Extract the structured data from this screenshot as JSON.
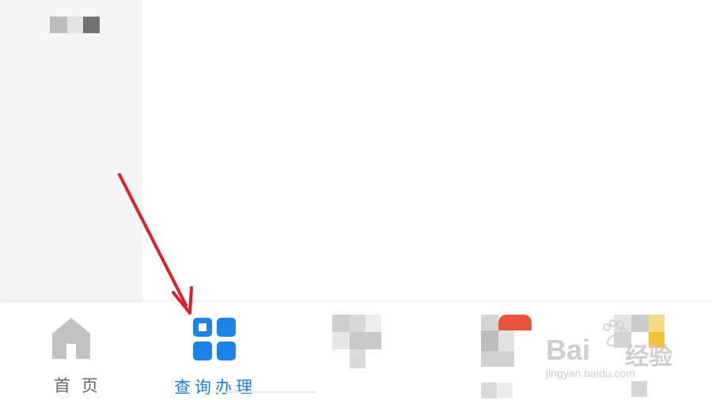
{
  "tabbar": {
    "items": [
      {
        "label": "首页",
        "icon": "home-icon",
        "active": false
      },
      {
        "label": "查询办理",
        "icon": "grid-icon",
        "active": true
      },
      {
        "label": "",
        "icon": "blurred-icon",
        "active": false
      },
      {
        "label": "",
        "icon": "blurred-icon",
        "active": false
      },
      {
        "label": "",
        "icon": "blurred-icon",
        "active": false
      }
    ]
  },
  "colors": {
    "active": "#1a82e8",
    "inactive": "#666666",
    "home_icon": "#c2c2c2",
    "arrow": "#e01f2c",
    "badge": "#e8543a",
    "left_panel": "#f5f5f5"
  },
  "annotation": {
    "type": "red-arrow",
    "points_to": "查询办理"
  },
  "watermark": {
    "brand": "Bai",
    "brand_cn": "经验",
    "url": "jingyan.baidu.com"
  }
}
